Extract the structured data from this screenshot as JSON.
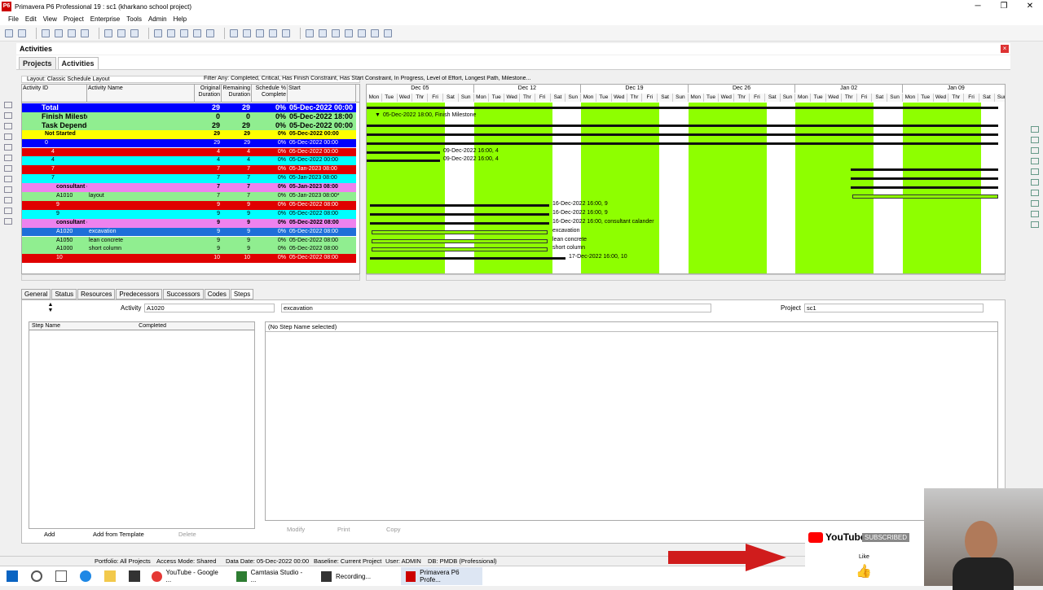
{
  "window": {
    "title": "Primavera P6 Professional 19 : sc1 (kharkano school project)",
    "logo": "P6"
  },
  "menu": [
    "File",
    "Edit",
    "View",
    "Project",
    "Enterprise",
    "Tools",
    "Admin",
    "Help"
  ],
  "panel": {
    "title": "Activities",
    "tabs": [
      "Projects",
      "Activities"
    ]
  },
  "layout_label": "Layout: Classic Schedule Layout",
  "filter_label": "Filter Any: Completed, Critical, Has Finish Constraint, Has Start Constraint, In Progress, Level of Effort, Longest Path, Milestone...",
  "columns": {
    "id": "Activity ID",
    "name": "Activity Name",
    "od": "Original Duration",
    "rd": "Remaining Duration",
    "pc": "Schedule % Complete",
    "start": "Start"
  },
  "rows": [
    {
      "id": "Total",
      "name": "",
      "od": "29",
      "rd": "29",
      "pc": "0%",
      "start": "05-Dec-2022 00:00",
      "color": "#0000ff",
      "fg": "#fff"
    },
    {
      "id": "Finish Milestone",
      "name": "",
      "od": "0",
      "rd": "0",
      "pc": "0%",
      "start": "05-Dec-2022 18:00",
      "color": "#90ee90",
      "fg": "#000"
    },
    {
      "id": "Task Dependent",
      "name": "",
      "od": "29",
      "rd": "29",
      "pc": "0%",
      "start": "05-Dec-2022 00:00",
      "color": "#90ee90",
      "fg": "#000"
    },
    {
      "id": "Not Started",
      "name": "",
      "od": "29",
      "rd": "29",
      "pc": "0%",
      "start": "05-Dec-2022 00:00",
      "color": "#ffff00",
      "fg": "#000"
    },
    {
      "id": "0",
      "name": "",
      "od": "29",
      "rd": "29",
      "pc": "0%",
      "start": "05-Dec-2022 00:00",
      "color": "#0000ff",
      "fg": "#fff"
    },
    {
      "id": "4",
      "name": "",
      "od": "4",
      "rd": "4",
      "pc": "0%",
      "start": "05-Dec-2022 00:00",
      "color": "#e00000",
      "fg": "#fff"
    },
    {
      "id": "4",
      "name": "",
      "od": "4",
      "rd": "4",
      "pc": "0%",
      "start": "05-Dec-2022 00:00",
      "color": "#00ffff",
      "fg": "#000"
    },
    {
      "id": "7",
      "name": "",
      "od": "7",
      "rd": "7",
      "pc": "0%",
      "start": "05-Jan-2023 08:00",
      "color": "#e00000",
      "fg": "#fff"
    },
    {
      "id": "7",
      "name": "",
      "od": "7",
      "rd": "7",
      "pc": "0%",
      "start": "05-Jan-2023 08:00",
      "color": "#00ffff",
      "fg": "#000"
    },
    {
      "id": "consultant calander",
      "name": "",
      "od": "7",
      "rd": "7",
      "pc": "0%",
      "start": "05-Jan-2023 08:00",
      "color": "#ee82ee",
      "fg": "#000"
    },
    {
      "id": "A1010",
      "name": "layout",
      "od": "7",
      "rd": "7",
      "pc": "0%",
      "start": "05-Jan-2023 08:00*",
      "color": "#90ee90",
      "fg": "#000"
    },
    {
      "id": "9",
      "name": "",
      "od": "9",
      "rd": "9",
      "pc": "0%",
      "start": "05-Dec-2022 08:00",
      "color": "#e00000",
      "fg": "#fff"
    },
    {
      "id": "9",
      "name": "",
      "od": "9",
      "rd": "9",
      "pc": "0%",
      "start": "05-Dec-2022 08:00",
      "color": "#00ffff",
      "fg": "#000"
    },
    {
      "id": "consultant calander",
      "name": "",
      "od": "9",
      "rd": "9",
      "pc": "0%",
      "start": "05-Dec-2022 08:00",
      "color": "#ee82ee",
      "fg": "#000"
    },
    {
      "id": "A1020",
      "name": "excavation",
      "od": "9",
      "rd": "9",
      "pc": "0%",
      "start": "05-Dec-2022 08:00",
      "color": "#1e6fd9",
      "fg": "#fff"
    },
    {
      "id": "A1050",
      "name": "lean concrete",
      "od": "9",
      "rd": "9",
      "pc": "0%",
      "start": "05-Dec-2022 08:00",
      "color": "#90ee90",
      "fg": "#000"
    },
    {
      "id": "A1000",
      "name": "short column",
      "od": "9",
      "rd": "9",
      "pc": "0%",
      "start": "05-Dec-2022 08:00",
      "color": "#90ee90",
      "fg": "#000"
    },
    {
      "id": "10",
      "name": "",
      "od": "10",
      "rd": "10",
      "pc": "0%",
      "start": "05-Dec-2022 08:00",
      "color": "#e00000",
      "fg": "#fff"
    }
  ],
  "gantt": {
    "weeks": [
      "Dec 05",
      "Dec 12",
      "Dec 19",
      "Dec 26",
      "Jan 02",
      "Jan 09"
    ],
    "days": [
      "Mon",
      "Tue",
      "Wed",
      "Thr",
      "Fri",
      "Sat",
      "Sun"
    ],
    "labels": [
      "05-Dec-2022 18:00, Finish Milestone",
      "09-Dec-2022 16:00, 4",
      "09-Dec-2022 16:00, 4",
      "16-Dec-2022 16:00, 9",
      "16-Dec-2022 16:00, 9",
      "16-Dec-2022 16:00, consultant calander",
      "excavation",
      "lean concrete",
      "short column",
      "17-Dec-2022 16:00, 10"
    ]
  },
  "details": {
    "tabs": [
      "General",
      "Status",
      "Resources",
      "Predecessors",
      "Successors",
      "Codes",
      "Steps"
    ],
    "activity_label": "Activity",
    "activity_id": "A1020",
    "activity_name": "excavation",
    "project_label": "Project",
    "project_value": "sc1",
    "step_cols": [
      "Step Name",
      "Completed"
    ],
    "no_step": "(No Step Name selected)",
    "buttons": [
      "Add",
      "Add from Template",
      "Delete",
      "Modify",
      "Print",
      "Copy"
    ]
  },
  "status": [
    "Portfolio: All Projects",
    "Access Mode: Shared",
    "Data Date: 05-Dec-2022 00:00",
    "Baseline: Current Project",
    "User: ADMIN",
    "DB: PMDB (Professional)"
  ],
  "taskbar": [
    "YouTube - Google ...",
    "Camtasia Studio - ...",
    "Recording...",
    "Primavera P6 Profe..."
  ],
  "youtube": {
    "brand": "YouTube",
    "subscribed": "SUBSCRIBED",
    "like": "Like"
  },
  "colors": {
    "green_bar": "#8eff00",
    "accent": "#0000ff"
  }
}
